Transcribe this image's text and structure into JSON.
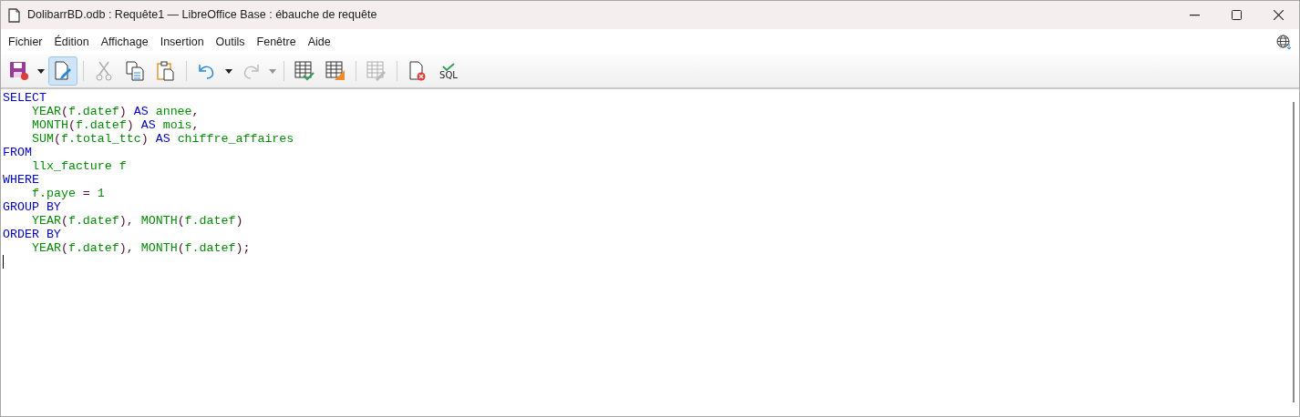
{
  "window": {
    "title": "DolibarrBD.odb : Requête1 — LibreOffice Base : ébauche de requête"
  },
  "menu": [
    "Fichier",
    "Édition",
    "Affichage",
    "Insertion",
    "Outils",
    "Fenêtre",
    "Aide"
  ],
  "toolbar": [
    {
      "kind": "save",
      "disabled": false,
      "dropdown": true
    },
    {
      "kind": "edit",
      "disabled": false,
      "active": true
    },
    {
      "kind": "sep"
    },
    {
      "kind": "cut",
      "disabled": true
    },
    {
      "kind": "copy",
      "disabled": false
    },
    {
      "kind": "paste",
      "disabled": false
    },
    {
      "kind": "sep"
    },
    {
      "kind": "undo",
      "disabled": false,
      "dropdown": true
    },
    {
      "kind": "redo",
      "disabled": true,
      "dropdown": true
    },
    {
      "kind": "sep"
    },
    {
      "kind": "run",
      "disabled": false
    },
    {
      "kind": "design",
      "disabled": false
    },
    {
      "kind": "sep"
    },
    {
      "kind": "table",
      "disabled": true
    },
    {
      "kind": "sep"
    },
    {
      "kind": "clear",
      "disabled": false
    },
    {
      "kind": "sql",
      "label": "SQL",
      "disabled": false
    }
  ],
  "code_lines": [
    {
      "indent": false,
      "tokens": [
        {
          "text": "SELECT",
          "kind": "keyword"
        }
      ]
    },
    {
      "indent": true,
      "tokens": [
        {
          "text": "YEAR",
          "kind": "name"
        },
        {
          "text": "(",
          "kind": "punct"
        },
        {
          "text": "f.datef",
          "kind": "name"
        },
        {
          "text": ")",
          "kind": "punct"
        },
        {
          "text": " AS ",
          "kind": "keyword"
        },
        {
          "text": "annee",
          "kind": "name"
        },
        {
          "text": ",",
          "kind": "punct"
        }
      ]
    },
    {
      "indent": true,
      "tokens": [
        {
          "text": "MONTH",
          "kind": "name"
        },
        {
          "text": "(",
          "kind": "punct"
        },
        {
          "text": "f.datef",
          "kind": "name"
        },
        {
          "text": ")",
          "kind": "punct"
        },
        {
          "text": " AS ",
          "kind": "keyword"
        },
        {
          "text": "mois",
          "kind": "name"
        },
        {
          "text": ",",
          "kind": "punct"
        }
      ]
    },
    {
      "indent": true,
      "tokens": [
        {
          "text": "SUM",
          "kind": "name"
        },
        {
          "text": "(",
          "kind": "punct"
        },
        {
          "text": "f.total_ttc",
          "kind": "name"
        },
        {
          "text": ")",
          "kind": "punct"
        },
        {
          "text": " AS ",
          "kind": "keyword"
        },
        {
          "text": "chiffre_affaires",
          "kind": "name"
        }
      ]
    },
    {
      "indent": false,
      "tokens": [
        {
          "text": "FROM",
          "kind": "keyword"
        }
      ]
    },
    {
      "indent": true,
      "tokens": [
        {
          "text": "llx_facture f",
          "kind": "name"
        }
      ]
    },
    {
      "indent": false,
      "tokens": [
        {
          "text": "WHERE",
          "kind": "keyword"
        }
      ]
    },
    {
      "indent": true,
      "tokens": [
        {
          "text": "f.paye",
          "kind": "name"
        },
        {
          "text": " = ",
          "kind": "punct"
        },
        {
          "text": "1",
          "kind": "name"
        }
      ]
    },
    {
      "indent": false,
      "tokens": [
        {
          "text": "GROUP BY",
          "kind": "keyword"
        }
      ]
    },
    {
      "indent": true,
      "tokens": [
        {
          "text": "YEAR",
          "kind": "name"
        },
        {
          "text": "(",
          "kind": "punct"
        },
        {
          "text": "f.datef",
          "kind": "name"
        },
        {
          "text": "), ",
          "kind": "punct"
        },
        {
          "text": "MONTH",
          "kind": "name"
        },
        {
          "text": "(",
          "kind": "punct"
        },
        {
          "text": "f.datef",
          "kind": "name"
        },
        {
          "text": ")",
          "kind": "punct"
        }
      ]
    },
    {
      "indent": false,
      "tokens": [
        {
          "text": "ORDER BY",
          "kind": "keyword"
        }
      ]
    },
    {
      "indent": true,
      "tokens": [
        {
          "text": "YEAR",
          "kind": "name"
        },
        {
          "text": "(",
          "kind": "punct"
        },
        {
          "text": "f.datef",
          "kind": "name"
        },
        {
          "text": "), ",
          "kind": "punct"
        },
        {
          "text": "MONTH",
          "kind": "name"
        },
        {
          "text": "(",
          "kind": "punct"
        },
        {
          "text": "f.datef",
          "kind": "name"
        },
        {
          "text": ");",
          "kind": "punct"
        }
      ]
    }
  ]
}
